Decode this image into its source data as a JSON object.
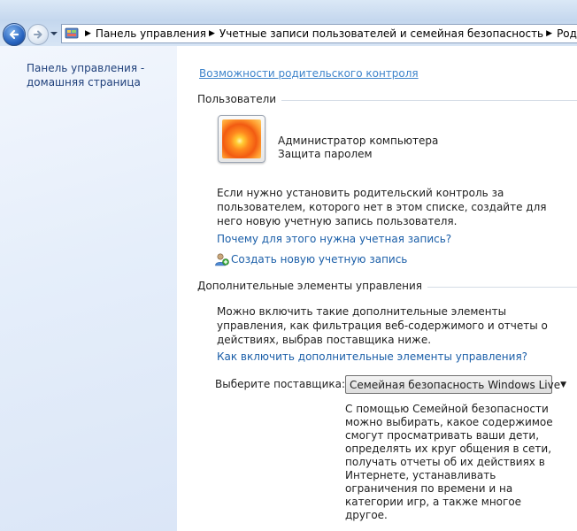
{
  "breadcrumb": {
    "items": [
      "Панель управления",
      "Учетные записи пользователей и семейная безопасность",
      "Родительский контроль"
    ]
  },
  "left_pane": {
    "home_link": "Панель управления - домашняя страница"
  },
  "main": {
    "top_link": "Возможности родительского контроля",
    "users_section": {
      "title": "Пользователи",
      "user": {
        "name": "Администратор компьютера",
        "status": "Защита паролем"
      },
      "hint": "Если нужно установить родительский контроль за пользователем, которого нет в этом списке, создайте для него новую учетную запись пользователя.",
      "why_link": "Почему для этого нужна учетная запись?",
      "create_link": "Создать новую учетную запись"
    },
    "extra_section": {
      "title": "Дополнительные элементы управления",
      "hint": "Можно включить такие дополнительные элементы управления, как фильтрация веб-содержимого и отчеты о действиях, выбрав поставщика ниже.",
      "how_link": "Как включить дополнительные элементы управления?",
      "provider_label": "Выберите поставщика:",
      "provider_value": "Семейная безопасность Windows Live",
      "provider_description": "С помощью Семейной безопасности можно выбирать, какое содержимое смогут просматривать ваши дети, определять их круг общения в сети, получать отчеты об их действиях в Интернете, устанавливать ограничения по времени и на категории игр, а также многое другое."
    }
  },
  "icons": [
    "back-arrow-icon",
    "forward-arrow-icon",
    "dropdown-arrow-icon",
    "control-panel-icon",
    "breadcrumb-arrow-icon",
    "add-user-icon",
    "user-picture-icon",
    "chevron-down-icon"
  ],
  "colors": {
    "link": "#1a5ea8",
    "left_pane": "#e5eefa",
    "header": "#c4d7ee"
  }
}
